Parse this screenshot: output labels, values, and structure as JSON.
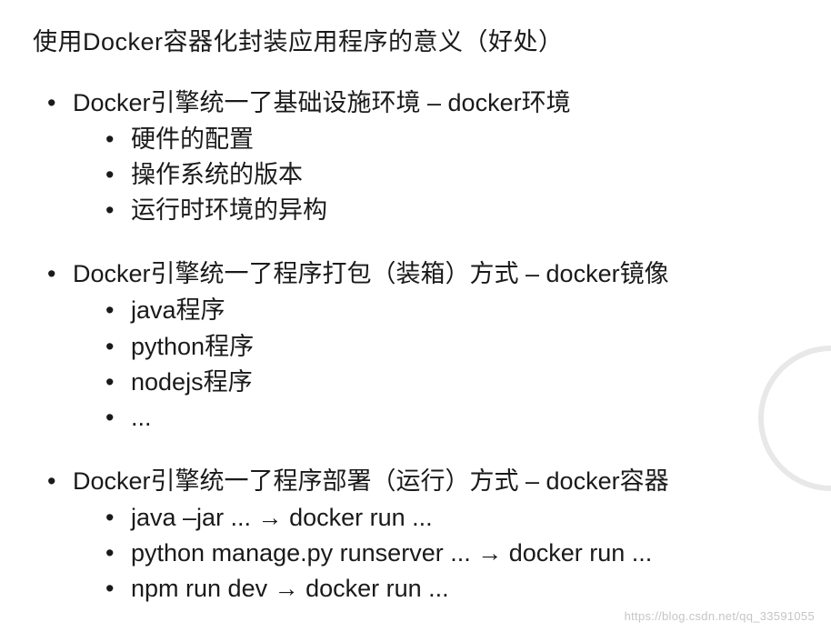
{
  "title": "使用Docker容器化封装应用程序的意义（好处）",
  "sections": [
    {
      "heading": "Docker引擎统一了基础设施环境 – docker环境",
      "items": [
        "硬件的配置",
        "操作系统的版本",
        "运行时环境的异构"
      ]
    },
    {
      "heading": "Docker引擎统一了程序打包（装箱）方式 – docker镜像",
      "items": [
        "java程序",
        "python程序",
        "nodejs程序",
        "..."
      ]
    },
    {
      "heading": "Docker引擎统一了程序部署（运行）方式 – docker容器",
      "items": [
        "java –jar ... → docker run ...",
        "python manage.py runserver ... →  docker run ...",
        "npm run dev → docker run ..."
      ]
    }
  ],
  "bullet": "•",
  "watermark": "https://blog.csdn.net/qq_33591055"
}
